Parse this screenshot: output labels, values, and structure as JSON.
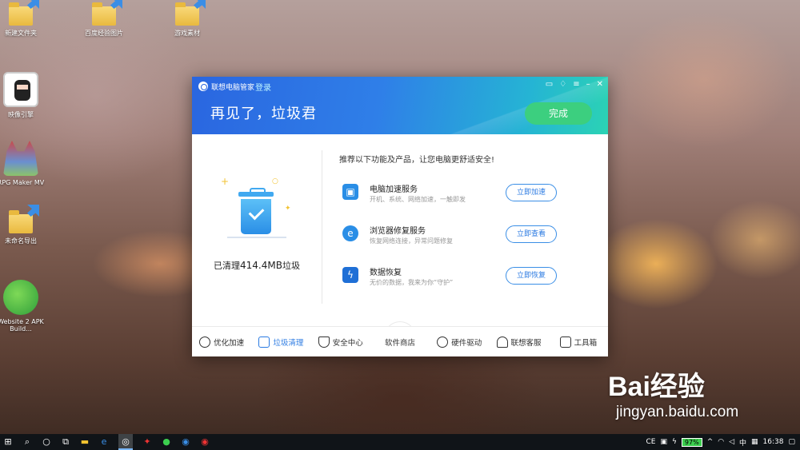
{
  "desktop": {
    "icons": [
      {
        "label": "新建文件夹"
      },
      {
        "label": "百度经验图片"
      },
      {
        "label": "游戏素材"
      },
      {
        "label": "映像引擎"
      },
      {
        "label": "RPG Maker MV"
      },
      {
        "label": "未命名导出"
      },
      {
        "label": "Website 2 APK Build..."
      }
    ]
  },
  "window": {
    "app_name": "联想电脑管家",
    "login_label": "登录",
    "headline": "再见了，垃圾君",
    "done_label": "完成",
    "cleaned_prefix": "已清理",
    "cleaned_amount": "414.4MB",
    "cleaned_suffix": "垃圾",
    "recommend_title": "推荐以下功能及产品，让您电脑更舒适安全!",
    "services": [
      {
        "name": "电脑加速服务",
        "desc": "开机、系统、网络加速，一触即发",
        "button": "立即加速",
        "icon": "monitor-icon"
      },
      {
        "name": "浏览器修复服务",
        "desc": "恢复网络连接，异常问题修复",
        "button": "立即查看",
        "icon": "ie-browser-icon"
      },
      {
        "name": "数据恢复",
        "desc": "无价的数据，我来为你“守护”",
        "button": "立即恢复",
        "icon": "data-recovery-icon"
      }
    ],
    "nav": [
      {
        "label": "优化加速",
        "icon": "speed-icon"
      },
      {
        "label": "垃圾清理",
        "icon": "trash-icon",
        "active": true
      },
      {
        "label": "安全中心",
        "icon": "shield-icon"
      },
      {
        "label": "软件商店",
        "icon": "store-icon"
      },
      {
        "label": "硬件驱动",
        "icon": "driver-icon"
      },
      {
        "label": "联想客服",
        "icon": "headset-icon"
      },
      {
        "label": "工具箱",
        "icon": "toolbox-icon"
      }
    ]
  },
  "taskbar": {
    "battery": "97%",
    "ime": "中",
    "time": "16:38"
  },
  "watermark": {
    "brand": "Bai经验",
    "url": "jingyan.baidu.com"
  }
}
